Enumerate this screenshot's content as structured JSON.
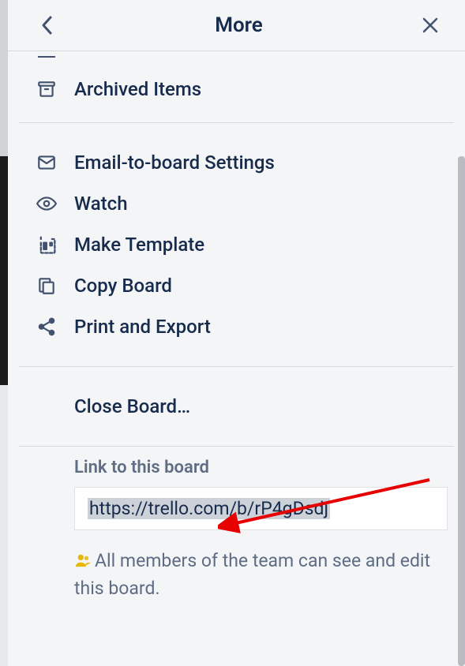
{
  "header": {
    "title": "More"
  },
  "menu": {
    "archived_items": "Archived Items",
    "email_settings": "Email-to-board Settings",
    "watch": "Watch",
    "make_template": "Make Template",
    "copy_board": "Copy Board",
    "print_export": "Print and Export",
    "close_board": "Close Board…"
  },
  "link_section": {
    "label": "Link to this board",
    "url": "https://trello.com/b/rP4gDsdj",
    "permission_text": "All members of the team can see and edit this board."
  }
}
